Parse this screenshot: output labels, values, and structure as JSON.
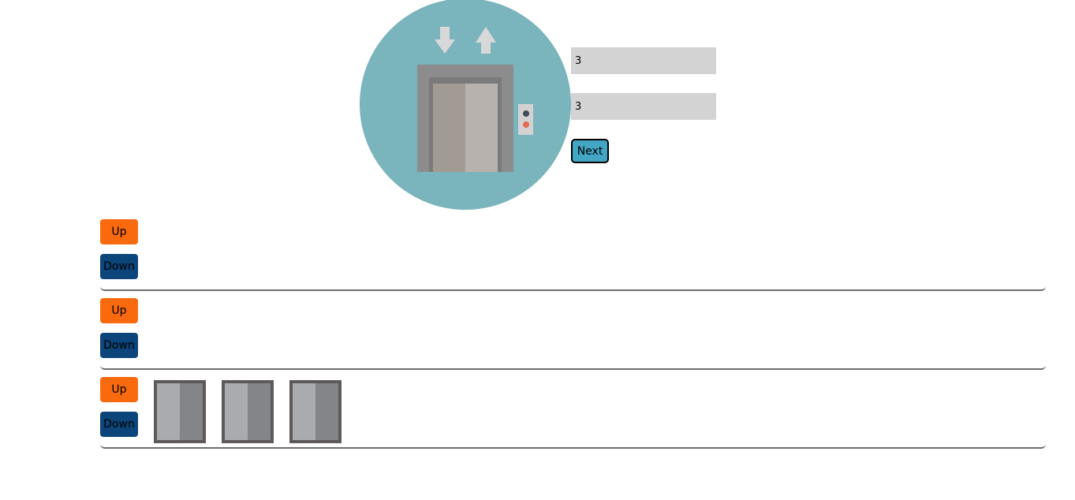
{
  "controls": {
    "floors_value": "3",
    "elevators_value": "3",
    "next_label": "Next"
  },
  "floors": [
    {
      "up_label": "Up",
      "down_label": "Down",
      "elevators": 0
    },
    {
      "up_label": "Up",
      "down_label": "Down",
      "elevators": 0
    },
    {
      "up_label": "Up",
      "down_label": "Down",
      "elevators": 3
    }
  ],
  "colors": {
    "logo_circle": "#7ab4bd",
    "up_button": "#f96a0f",
    "down_button": "#0b457a",
    "next_button": "#42a6c4",
    "input_bg": "#d3d3d3"
  }
}
